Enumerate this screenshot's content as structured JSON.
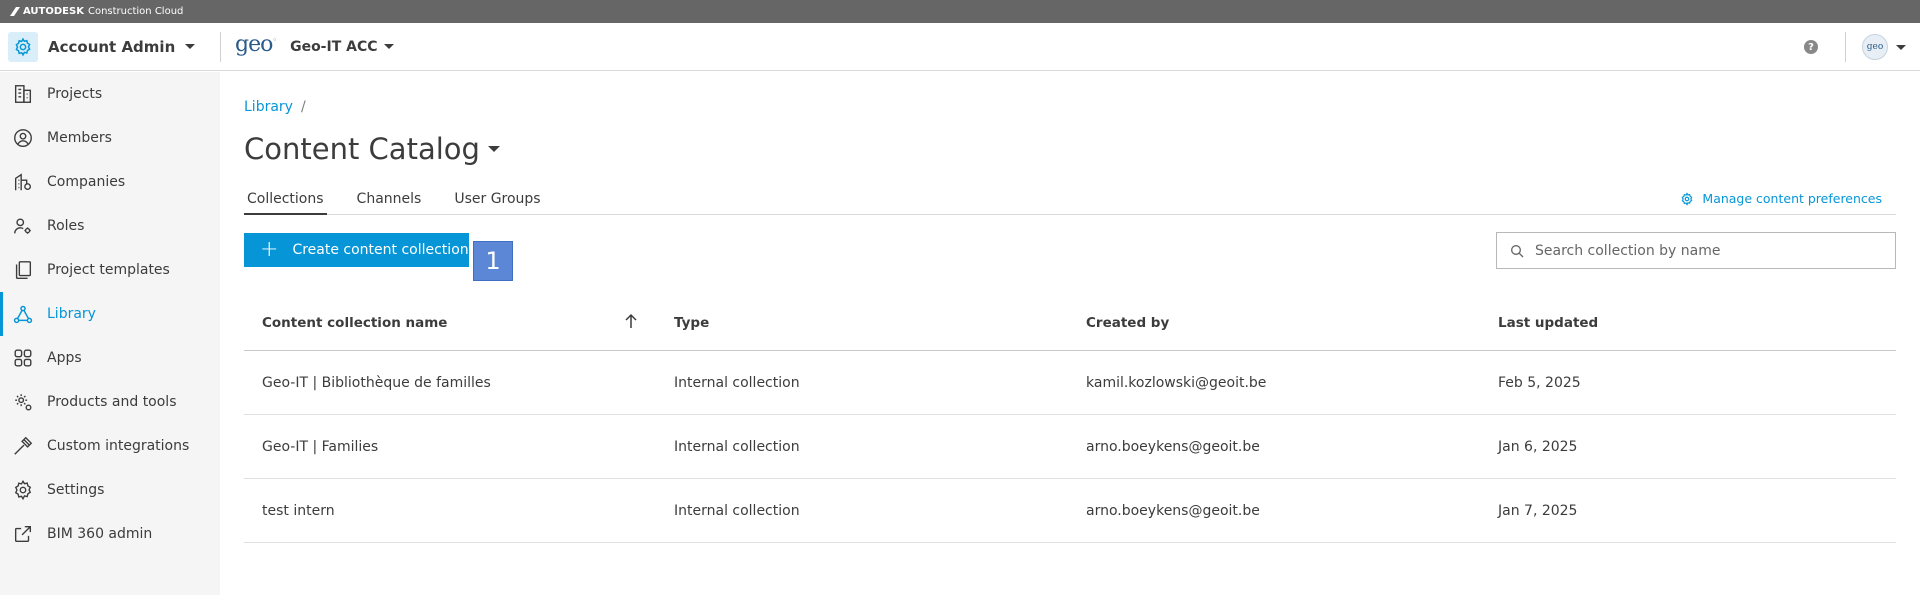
{
  "brand": {
    "name_bold": "AUTODESK",
    "name_rest": "Construction Cloud"
  },
  "header": {
    "account_label": "Account Admin",
    "logo_text": "geo",
    "project_label": "Geo-IT ACC",
    "help_glyph": "?",
    "avatar_text": "geo"
  },
  "sidebar": {
    "items": [
      {
        "label": "Projects",
        "icon": "building-icon"
      },
      {
        "label": "Members",
        "icon": "user-circle-icon"
      },
      {
        "label": "Companies",
        "icon": "company-icon"
      },
      {
        "label": "Roles",
        "icon": "user-gear-icon"
      },
      {
        "label": "Project templates",
        "icon": "templates-icon"
      },
      {
        "label": "Library",
        "icon": "library-icon"
      },
      {
        "label": "Apps",
        "icon": "apps-grid-icon"
      },
      {
        "label": "Products and tools",
        "icon": "products-gear-icon"
      },
      {
        "label": "Custom integrations",
        "icon": "hammer-icon"
      },
      {
        "label": "Settings",
        "icon": "gear-icon"
      },
      {
        "label": "BIM 360 admin",
        "icon": "external-link-icon"
      }
    ],
    "active": "Library"
  },
  "main": {
    "breadcrumb": {
      "root": "Library",
      "sep": "/"
    },
    "title": "Content Catalog",
    "tabs": [
      {
        "label": "Collections"
      },
      {
        "label": "Channels"
      },
      {
        "label": "User Groups"
      }
    ],
    "manage_label": "Manage content preferences",
    "create_label": "Create content collection",
    "step_badge": "1",
    "search_placeholder": "Search collection by name"
  },
  "table": {
    "columns": [
      "Content collection name",
      "Type",
      "Created by",
      "Last updated"
    ],
    "rows": [
      {
        "name": "Geo-IT | Bibliothèque de familles",
        "type": "Internal collection",
        "created_by": "kamil.kozlowski@geoit.be",
        "updated": "Feb 5, 2025"
      },
      {
        "name": "Geo-IT | Families",
        "type": "Internal collection",
        "created_by": "arno.boeykens@geoit.be",
        "updated": "Jan 6, 2025"
      },
      {
        "name": "test intern",
        "type": "Internal collection",
        "created_by": "arno.boeykens@geoit.be",
        "updated": "Jan 7, 2025"
      }
    ]
  },
  "colors": {
    "accent": "#0696d7",
    "sidebar_bg": "#f5f5f5",
    "brandbar": "#666666",
    "badge": "#5b87d6"
  }
}
